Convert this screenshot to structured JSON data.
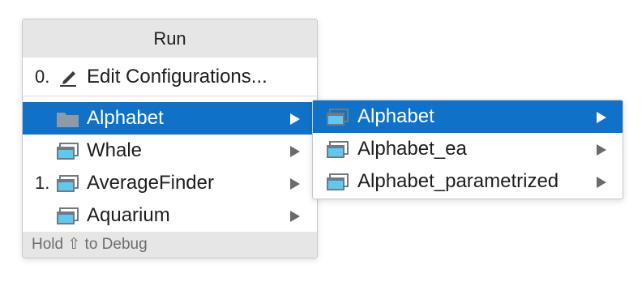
{
  "popup": {
    "title": "Run",
    "edit_item": {
      "mnemonic": "0.",
      "label": "Edit Configurations...",
      "icon": "pencil-icon"
    },
    "items": [
      {
        "mnemonic": "",
        "label": "Alphabet",
        "icon": "folder-icon",
        "selected": true
      },
      {
        "mnemonic": "",
        "label": "Whale",
        "icon": "run-config-icon",
        "selected": false
      },
      {
        "mnemonic": "1.",
        "label": "AverageFinder",
        "icon": "run-config-icon",
        "selected": false
      },
      {
        "mnemonic": "",
        "label": "Aquarium",
        "icon": "run-config-icon",
        "selected": false
      }
    ],
    "footer": "Hold ⇧ to Debug"
  },
  "submenu": {
    "items": [
      {
        "label": "Alphabet",
        "icon": "run-config-icon",
        "selected": true
      },
      {
        "label": "Alphabet_ea",
        "icon": "run-config-icon",
        "selected": false
      },
      {
        "label": "Alphabet_parametrized",
        "icon": "run-config-icon",
        "selected": false
      }
    ]
  },
  "colors": {
    "selection": "#0f72c8",
    "header_bg": "#e6e6e6",
    "config_icon_fill": "#5fc8ee",
    "config_icon_frame": "#6f7a86",
    "folder": "#8e9aa8"
  }
}
